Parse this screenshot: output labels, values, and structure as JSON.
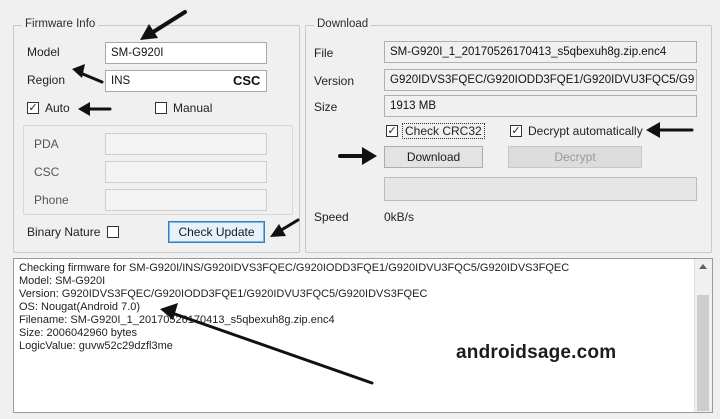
{
  "firmware_info": {
    "title": "Firmware Info",
    "model_label": "Model",
    "model_value": "SM-G920I",
    "region_label": "Region",
    "region_value": "INS",
    "region_annotation": "CSC",
    "auto_label": "Auto",
    "auto_checked": "✓",
    "manual_label": "Manual",
    "pda_label": "PDA",
    "csc_label": "CSC",
    "phone_label": "Phone",
    "binary_nature_label": "Binary Nature",
    "check_update_label": "Check Update"
  },
  "download": {
    "title": "Download",
    "file_label": "File",
    "file_value": "SM-G920I_1_20170526170413_s5qbexuh8g.zip.enc4",
    "version_label": "Version",
    "version_value": "G920IDVS3FQEC/G920IODD3FQE1/G920IDVU3FQC5/G9",
    "size_label": "Size",
    "size_value": "1913 MB",
    "check_crc32_label": "Check CRC32",
    "check_crc32_checked": "✓",
    "decrypt_auto_label": "Decrypt automatically",
    "decrypt_auto_checked": "✓",
    "download_button": "Download",
    "decrypt_button": "Decrypt",
    "speed_label": "Speed",
    "speed_value": "0kB/s"
  },
  "log": {
    "lines": [
      "Checking firmware for SM-G920I/INS/G920IDVS3FQEC/G920IODD3FQE1/G920IDVU3FQC5/G920IDVS3FQEC",
      "Model: SM-G920I",
      "Version: G920IDVS3FQEC/G920IODD3FQE1/G920IDVU3FQC5/G920IDVS3FQEC",
      "OS: Nougat(Android 7.0)",
      "Filename: SM-G920I_1_20170526170413_s5qbexuh8g.zip.enc4",
      "Size: 2006042960 bytes",
      "LogicValue: guvw52c29dzfl3me"
    ]
  },
  "watermark": "androidsage.com"
}
